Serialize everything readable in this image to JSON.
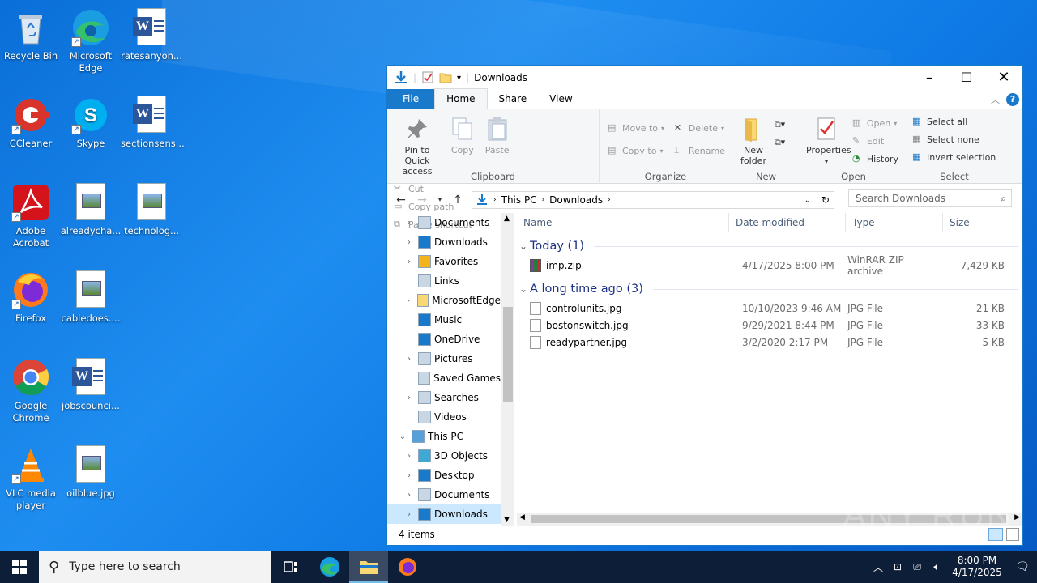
{
  "desktop": {
    "icons": [
      {
        "label": "Recycle Bin"
      },
      {
        "label": "Microsoft Edge"
      },
      {
        "label": "ratesanyon..."
      },
      {
        "label": "CCleaner"
      },
      {
        "label": "Skype"
      },
      {
        "label": "sectionsens..."
      },
      {
        "label": "Adobe Acrobat"
      },
      {
        "label": "alreadycha..."
      },
      {
        "label": "technolog..."
      },
      {
        "label": "Firefox"
      },
      {
        "label": "cabledoes...."
      },
      {
        "label": "Google Chrome"
      },
      {
        "label": "jobscounci..."
      },
      {
        "label": "VLC media player"
      },
      {
        "label": "oilblue.jpg"
      }
    ]
  },
  "explorer": {
    "title": "Downloads",
    "tabs": {
      "file": "File",
      "home": "Home",
      "share": "Share",
      "view": "View"
    },
    "ribbon": {
      "clipboard": {
        "name": "Clipboard",
        "pin": "Pin to Quick access",
        "copy": "Copy",
        "paste": "Paste",
        "cut": "Cut",
        "copy_path": "Copy path",
        "paste_shortcut": "Paste shortcut"
      },
      "organize": {
        "name": "Organize",
        "move_to": "Move to",
        "copy_to": "Copy to",
        "delete": "Delete",
        "rename": "Rename"
      },
      "new": {
        "name": "New",
        "new_folder": "New folder"
      },
      "open": {
        "name": "Open",
        "properties": "Properties",
        "open": "Open",
        "edit": "Edit",
        "history": "History"
      },
      "select": {
        "name": "Select",
        "select_all": "Select all",
        "select_none": "Select none",
        "invert": "Invert selection"
      }
    },
    "address": {
      "segments": [
        "This PC",
        "Downloads"
      ]
    },
    "search_placeholder": "Search Downloads",
    "nav_items": [
      {
        "label": "Documents",
        "expand": true
      },
      {
        "label": "Downloads",
        "expand": true
      },
      {
        "label": "Favorites",
        "expand": true
      },
      {
        "label": "Links",
        "expand": false
      },
      {
        "label": "MicrosoftEdge",
        "expand": true
      },
      {
        "label": "Music",
        "expand": false
      },
      {
        "label": "OneDrive",
        "expand": false
      },
      {
        "label": "Pictures",
        "expand": true
      },
      {
        "label": "Saved Games",
        "expand": false
      },
      {
        "label": "Searches",
        "expand": true
      },
      {
        "label": "Videos",
        "expand": false
      },
      {
        "label": "This PC",
        "expand": "open"
      },
      {
        "label": "3D Objects",
        "expand": true
      },
      {
        "label": "Desktop",
        "expand": true
      },
      {
        "label": "Documents",
        "expand": true
      },
      {
        "label": "Downloads",
        "expand": true
      }
    ],
    "columns": {
      "name": "Name",
      "date": "Date modified",
      "type": "Type",
      "size": "Size"
    },
    "groups": [
      {
        "title": "Today (1)",
        "files": [
          {
            "name": "imp.zip",
            "date": "4/17/2025 8:00 PM",
            "type": "WinRAR ZIP archive",
            "size": "7,429 KB",
            "kind": "zip"
          }
        ]
      },
      {
        "title": "A long time ago (3)",
        "files": [
          {
            "name": "controlunits.jpg",
            "date": "10/10/2023 9:46 AM",
            "type": "JPG File",
            "size": "21 KB",
            "kind": "jpg"
          },
          {
            "name": "bostonswitch.jpg",
            "date": "9/29/2021 8:44 PM",
            "type": "JPG File",
            "size": "33 KB",
            "kind": "jpg"
          },
          {
            "name": "readypartner.jpg",
            "date": "3/2/2020 2:17 PM",
            "type": "JPG File",
            "size": "5 KB",
            "kind": "jpg"
          }
        ]
      }
    ],
    "status": "4 items"
  },
  "taskbar": {
    "search_placeholder": "Type here to search",
    "time": "8:00 PM",
    "date": "4/17/2025"
  },
  "watermark": "ANY RUN"
}
